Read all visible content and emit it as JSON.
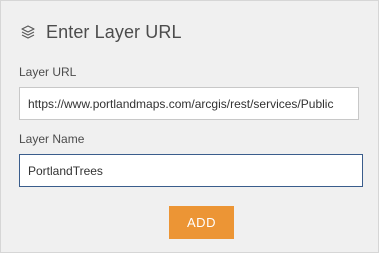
{
  "header": {
    "icon": "layers-icon",
    "title": "Enter Layer URL"
  },
  "form": {
    "layer_url": {
      "label": "Layer URL",
      "value": "https://www.portlandmaps.com/arcgis/rest/services/Public"
    },
    "layer_name": {
      "label": "Layer Name",
      "value": "PortlandTrees"
    },
    "add_label": "ADD"
  },
  "colors": {
    "panel_bg": "#f0f0f0",
    "accent_button": "#ec9535",
    "focus_border": "#3a5d8c",
    "text": "#4c4c4c"
  }
}
